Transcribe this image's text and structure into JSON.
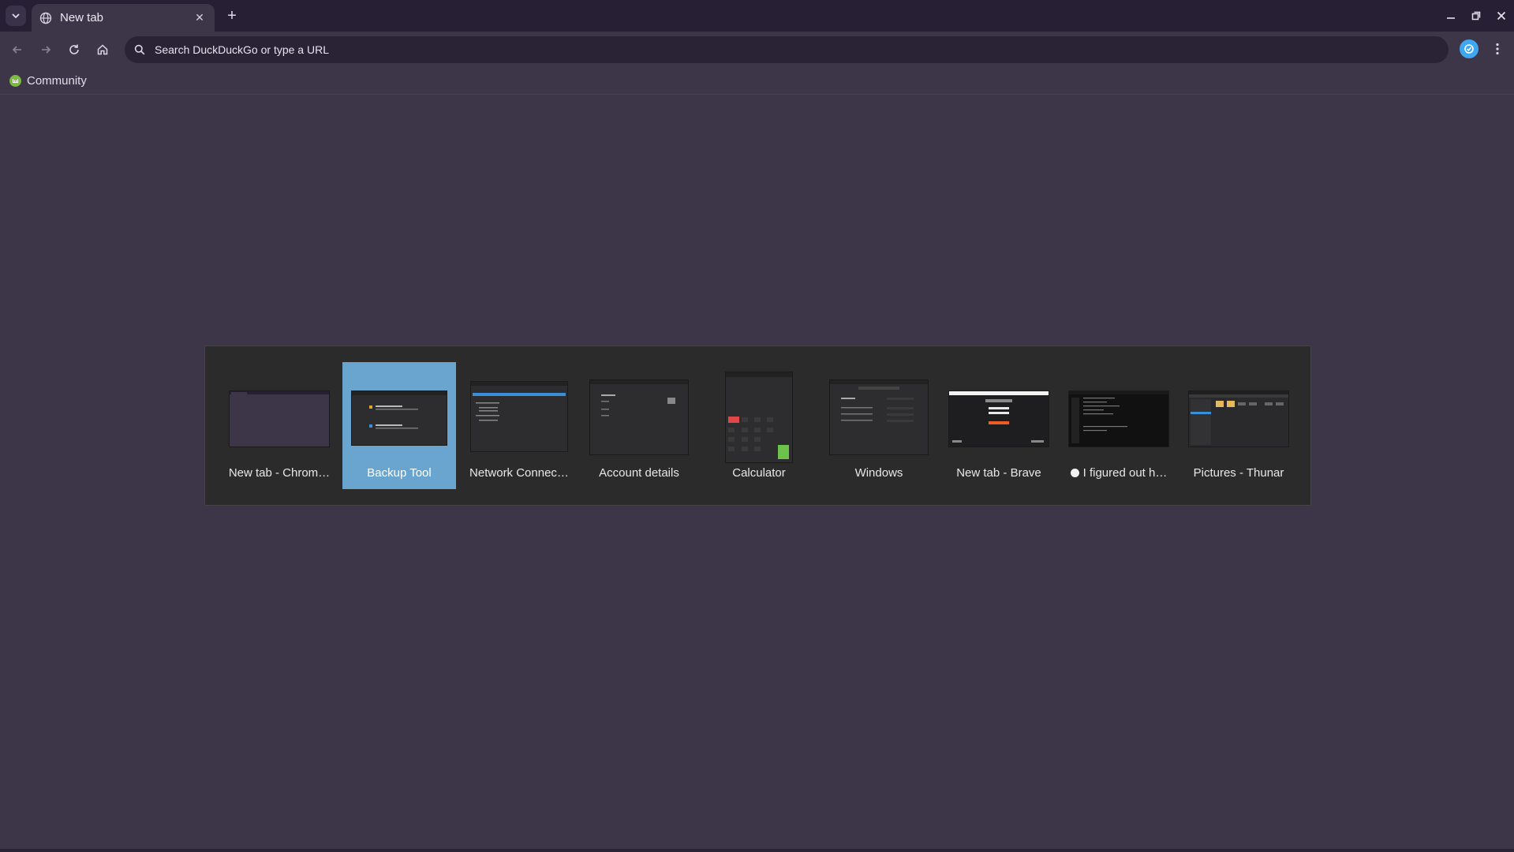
{
  "browser": {
    "tab": {
      "title": "New tab",
      "close_glyph": "✕"
    },
    "new_tab_glyph": "+",
    "tab_list_glyph": "⌄",
    "omnibox": {
      "placeholder": "Search DuckDuckGo or type a URL",
      "value": ""
    },
    "bookmarks": [
      {
        "label": "Community",
        "icon": "mint-community-icon"
      }
    ]
  },
  "switcher": {
    "items": [
      {
        "label": "New tab - Chrom…",
        "selected": false,
        "icon": "chromium-thumbnail"
      },
      {
        "label": "Backup Tool",
        "selected": true,
        "icon": "backup-tool-thumbnail"
      },
      {
        "label": "Network Connec…",
        "selected": false,
        "icon": "network-connections-thumbnail"
      },
      {
        "label": "Account details",
        "selected": false,
        "icon": "account-details-thumbnail"
      },
      {
        "label": "Calculator",
        "selected": false,
        "icon": "calculator-thumbnail"
      },
      {
        "label": "Windows",
        "selected": false,
        "icon": "windows-settings-thumbnail"
      },
      {
        "label": "New tab - Brave",
        "selected": false,
        "icon": "brave-thumbnail"
      },
      {
        "label": "I figured out h…",
        "selected": false,
        "icon": "terminal-thumbnail"
      },
      {
        "label": "Pictures - Thunar",
        "selected": false,
        "icon": "thunar-thumbnail"
      }
    ]
  },
  "colors": {
    "page_bg": "#3d3548",
    "tabstrip_bg": "#272034",
    "selection": "#6aa5cf",
    "switcher_bg": "#2b2b2b"
  }
}
